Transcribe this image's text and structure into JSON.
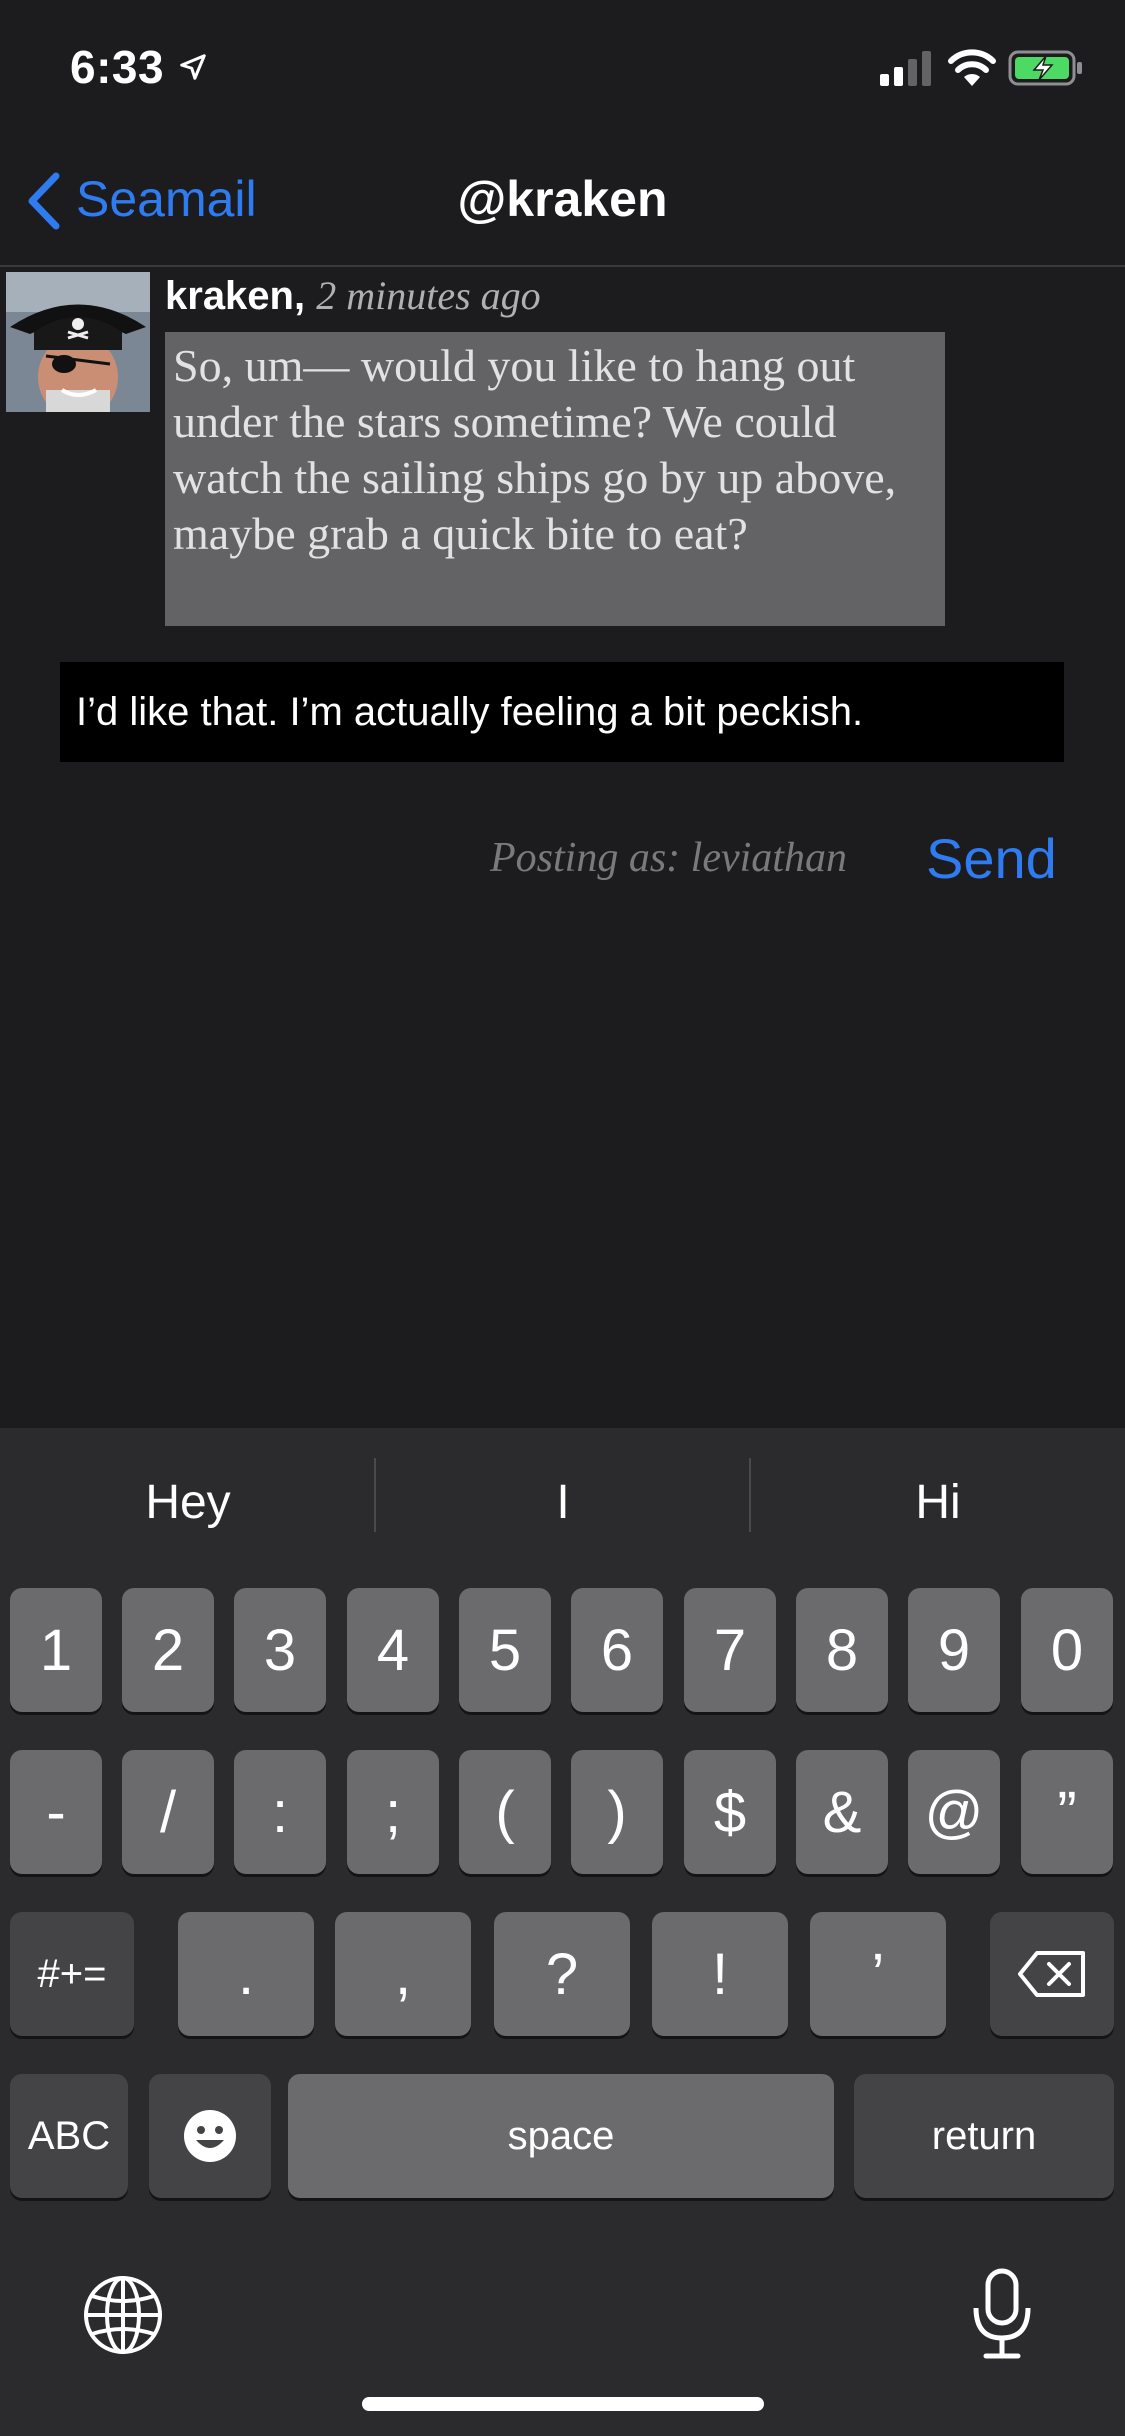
{
  "status_bar": {
    "time": "6:33"
  },
  "nav": {
    "back_label": "Seamail",
    "title": "@kraken"
  },
  "message": {
    "author": "kraken,",
    "time": "2 minutes ago",
    "text": "So, um— would you like to hang out under the stars sometime? We could watch the sailing ships go by up above, maybe grab a quick bite to eat?"
  },
  "reply": {
    "value": "I’d like that. I’m actually feeling a bit peckish.",
    "posting_as": "Posting as: leviathan",
    "send_label": "Send"
  },
  "keyboard": {
    "suggestions": [
      "Hey",
      "I",
      "Hi"
    ],
    "row1": [
      "1",
      "2",
      "3",
      "4",
      "5",
      "6",
      "7",
      "8",
      "9",
      "0"
    ],
    "row2": [
      "-",
      "/",
      ":",
      ";",
      "(",
      ")",
      "$",
      "&",
      "@",
      "”"
    ],
    "row3": [
      ".",
      ",",
      "?",
      "!",
      "’"
    ],
    "symbols_label": "#+=",
    "abc_label": "ABC",
    "space_label": "space",
    "return_label": "return"
  },
  "colors": {
    "accent": "#2f7bf0",
    "background": "#1c1c1e",
    "bubble": "#636366",
    "key": "#6b6b6e"
  }
}
